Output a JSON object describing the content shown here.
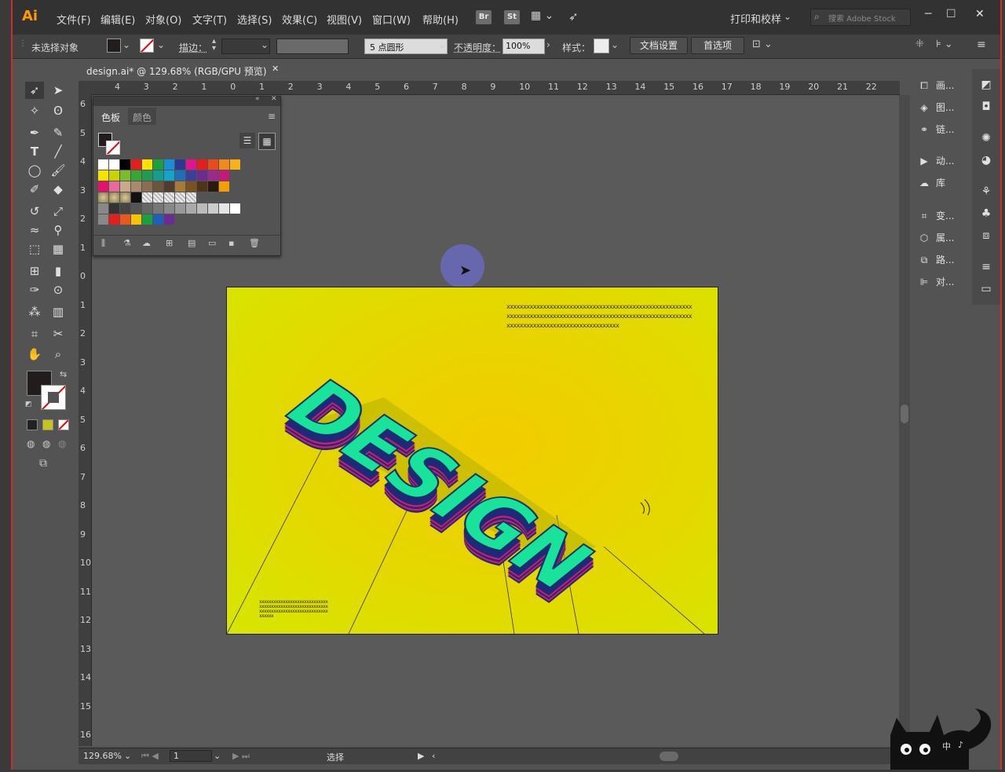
{
  "menubar": {
    "logo": "Ai",
    "items": [
      "文件(F)",
      "编辑(E)",
      "对象(O)",
      "文字(T)",
      "选择(S)",
      "效果(C)",
      "视图(V)",
      "窗口(W)",
      "帮助(H)"
    ],
    "bridge": "Br",
    "stock": "St",
    "workspace": "打印和校样",
    "search_placeholder": "搜索 Adobe Stock"
  },
  "controlbar": {
    "selection": "未选择对象",
    "stroke_label": "描边：",
    "brush": "5 点圆形",
    "opacity_label": "不透明度：",
    "opacity_value": "100%",
    "style_label": "样式：",
    "doc_settings": "文档设置",
    "preferences": "首选项"
  },
  "document": {
    "tab_title": "design.ai* @ 129.68% (RGB/GPU 预览)",
    "close": "✕"
  },
  "ruler": {
    "top": [
      "4",
      "3",
      "2",
      "1",
      "0",
      "1",
      "2",
      "3",
      "4",
      "5",
      "6",
      "7",
      "8",
      "9",
      "10",
      "11",
      "12",
      "13",
      "14",
      "15",
      "16",
      "17",
      "18",
      "19",
      "20",
      "21",
      "22"
    ],
    "left": [
      "6",
      "5",
      "4",
      "3",
      "2",
      "1",
      "0",
      "1",
      "2",
      "3",
      "4",
      "5",
      "6",
      "7",
      "8",
      "9",
      "10",
      "11",
      "12",
      "13",
      "14",
      "15",
      "16"
    ]
  },
  "swatches_panel": {
    "tabs": [
      "色板",
      "颜色"
    ],
    "row1": [
      "#ffffff",
      "#ffffff",
      "#000000",
      "#e21e1e",
      "#ffe100",
      "#1aa13b",
      "#1b8fd6",
      "#2a3a93",
      "#e0148c",
      "#e21e1e",
      "#e84b1c",
      "#f08a1c",
      "#f6b21a"
    ],
    "row2": [
      "#f4e400",
      "#c8d400",
      "#7dbb2e",
      "#3aa535",
      "#1f9b55",
      "#129e8e",
      "#13a5c7",
      "#1e6fb8",
      "#3b3f98",
      "#6c2b8f",
      "#9b2a8d",
      "#c3197c"
    ],
    "row3": [
      "#e0146e",
      "#e86a9c",
      "#c9a98e",
      "#a98a6e",
      "#8a6d52",
      "#6d543f",
      "#4f3c2d",
      "#a87a3a",
      "#7a5222",
      "#4e3418",
      "#2a1a0e",
      "#f0a000"
    ],
    "row5": [
      "#333333",
      "#444444",
      "#555555",
      "#666666",
      "#777777",
      "#888888",
      "#999999",
      "#aaaaaa",
      "#bbbbbb",
      "#cccccc",
      "#e5e5e5",
      "#ffffff"
    ],
    "row6": [
      "#e21e1e",
      "#e85a1c",
      "#f6c400",
      "#1aa13b",
      "#1e5fb8",
      "#6c2b8f"
    ]
  },
  "right_panel": {
    "items": [
      "画...",
      "图...",
      "链...",
      "动...",
      "库",
      "变...",
      "属...",
      "路...",
      "对..."
    ]
  },
  "artboard": {
    "headline": "DESIGN",
    "text_block_top": [
      "xxxxxxxxxxxxxxxxxxxxxxxxxxxxxxxxxxxxxxxxxxxxxxxxxxxxxxxx",
      "xxxxxxxxxxxxxxxxxxxxxxxxxxxxxxxxxxxxxxxxxxxxxxxxxxxxxxxx",
      "xxxxxxxxxxxxxxxxxxxxxxxxxxxxxxxxxx"
    ],
    "text_block_bottom": [
      "xxxxxxxxxxxxxxxxxxxxxxxxxxxxx",
      "xxxxxxxxxxxxxxxxxxxxxxxxxxxxx",
      "xxxxxxxxxxxxxxxxxxxxxxxxxxxxx",
      "xxxxxx"
    ]
  },
  "status": {
    "zoom": "129.68%",
    "page": "1",
    "tool": "选择"
  },
  "overlay": {
    "ime_top": "中",
    "ime_bottom": "♪"
  }
}
